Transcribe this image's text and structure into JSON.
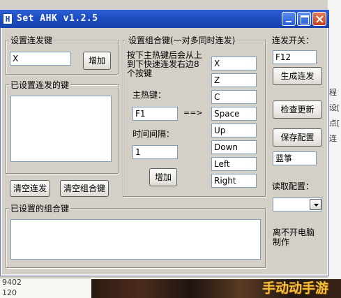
{
  "window": {
    "title": "Set AHK v1.2.5",
    "icon_letter": "H"
  },
  "rapid_key": {
    "group_label": "设置连发键",
    "input_value": "X",
    "add_label": "增加",
    "list_group_label": "已设置连发的键",
    "clear_rapid_label": "清空连发",
    "clear_combo_label": "清空组合键"
  },
  "combo": {
    "group_label": "设置组合键(一对多同时连发)",
    "instruction": "按下主热键后会从上到下快速连发右边8个按键",
    "hotkey_label": "主热键：",
    "hotkey_value": "F1",
    "arrow": "==>",
    "interval_label": "时间间隔：",
    "interval_value": "1",
    "add_label": "增加",
    "keys": [
      "X",
      "Z",
      "C",
      "Space",
      "Up",
      "Down",
      "Left",
      "Right"
    ]
  },
  "combo_list_label": "已设置的组合键",
  "right_panel": {
    "toggle_label": "连发开关：",
    "toggle_value": "F12",
    "generate_label": "生成连发",
    "check_update_label": "检查更新",
    "save_config_label": "保存配置",
    "config_name": "蓝箏",
    "load_config_label": "读取配置：",
    "footer_text": "离不开电脑制作"
  },
  "background": {
    "side_text": [
      "程",
      "设[",
      "点[",
      "连"
    ],
    "bottom_numbers": [
      "9402",
      "120"
    ],
    "watermark": "手动动手游"
  }
}
